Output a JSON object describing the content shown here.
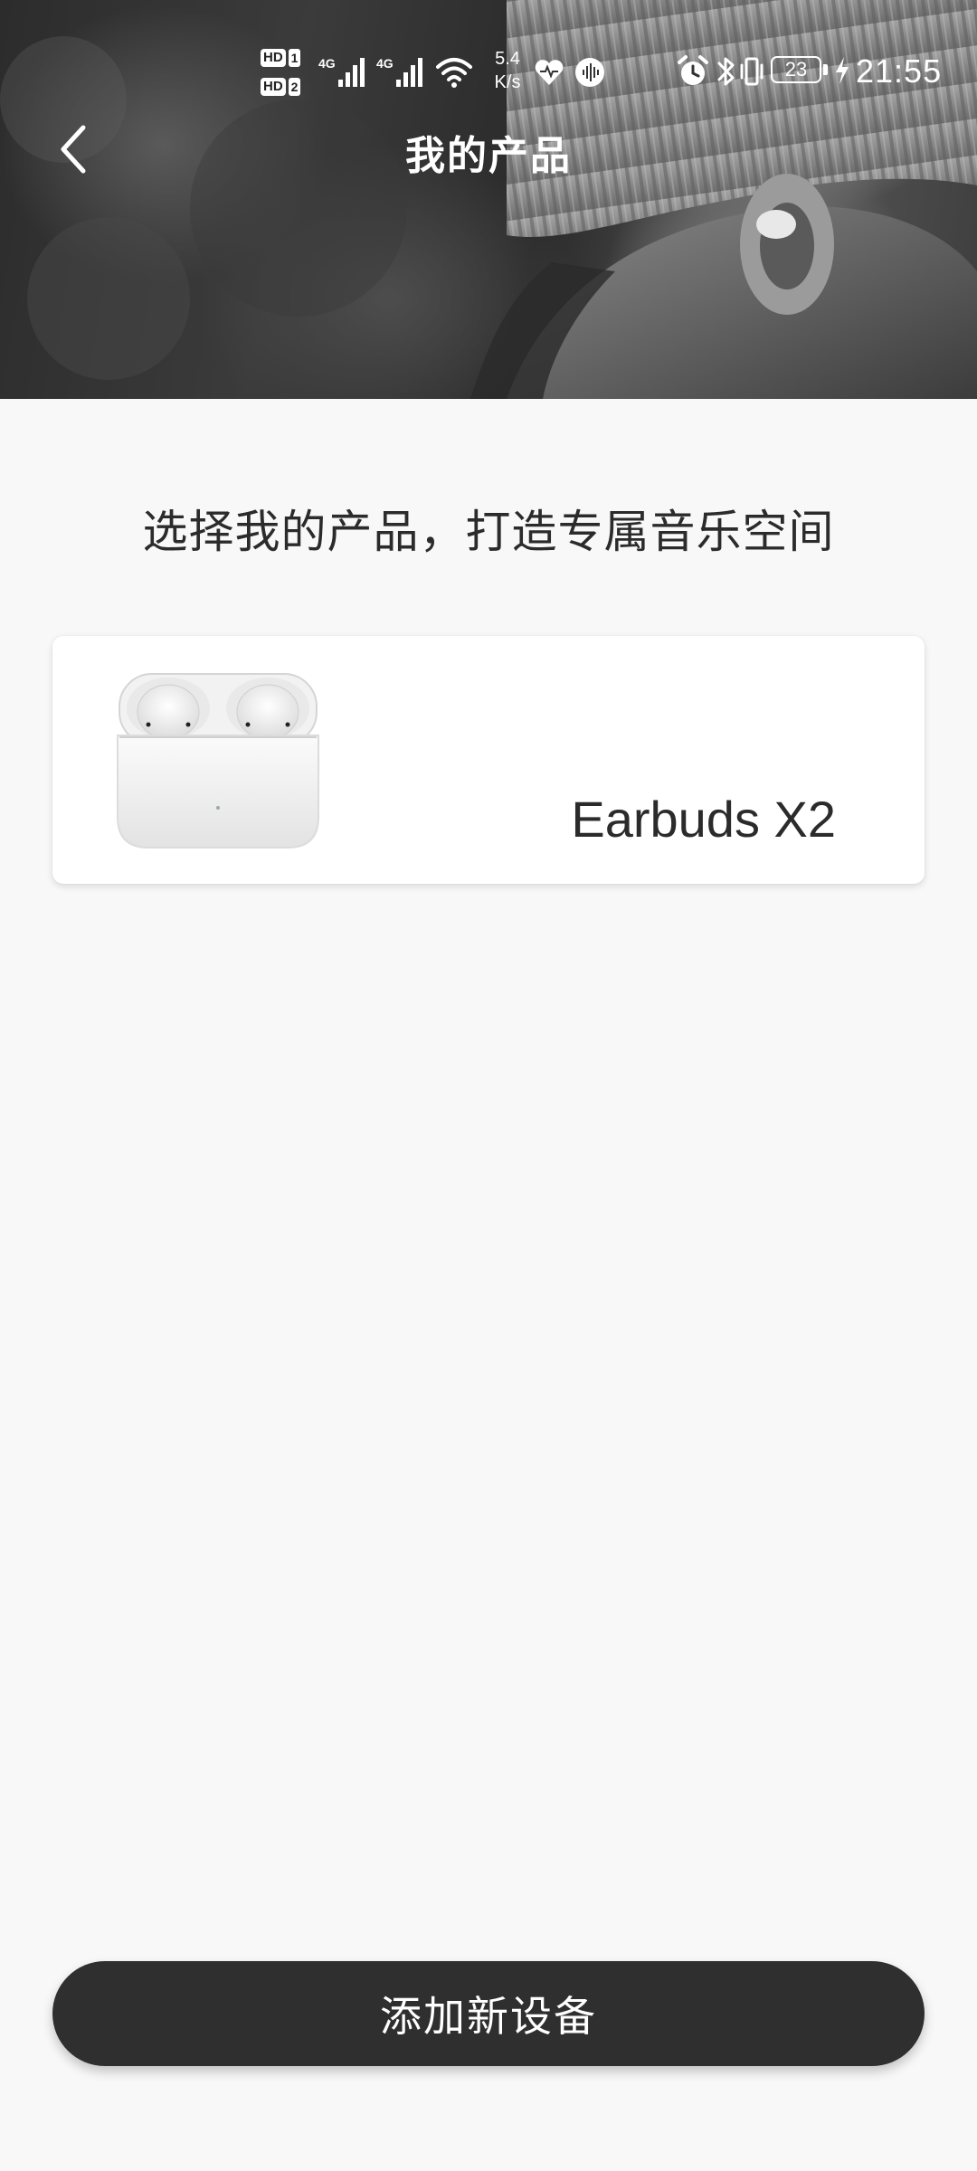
{
  "status_bar": {
    "hd1": "HD",
    "sim1": "1",
    "hd2": "HD",
    "sim2": "2",
    "network1": "4G",
    "network2": "4G",
    "speed_value": "5.4",
    "speed_unit": "K/s",
    "battery": "23",
    "time": "21:55"
  },
  "header": {
    "title": "我的产品"
  },
  "main": {
    "subtitle": "选择我的产品，打造专属音乐空间",
    "products": [
      {
        "name": "Earbuds X2"
      }
    ]
  },
  "footer": {
    "add_button_label": "添加新设备"
  }
}
